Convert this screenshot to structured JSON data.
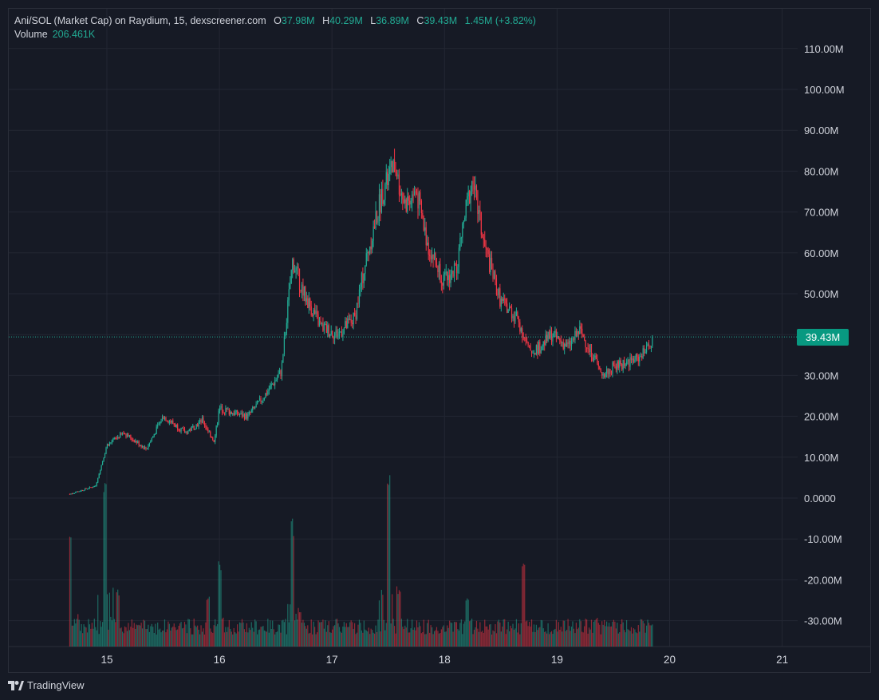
{
  "legend": {
    "title": "Ani/SOL (Market Cap) on Raydium, 15, dexscreener.com",
    "o_label": "O",
    "o_value": "37.98M",
    "h_label": "H",
    "h_value": "40.29M",
    "l_label": "L",
    "l_value": "36.89M",
    "c_label": "C",
    "c_value": "39.43M",
    "change": "1.45M (+3.82%)",
    "volume_label": "Volume",
    "volume_value": "206.461K"
  },
  "price_tag": "39.43M",
  "branding": "TradingView",
  "colors": {
    "background": "#161a25",
    "up": "#22ab94",
    "down": "#f23645",
    "grid": "#232733",
    "text": "#d1d4dc",
    "tag": "#089981"
  },
  "chart_data": {
    "type": "candlestick",
    "interval": "15",
    "yaxis_ticks": [
      "110.00M",
      "100.00M",
      "90.00M",
      "80.00M",
      "70.00M",
      "60.00M",
      "50.00M",
      "40.00M",
      "30.00M",
      "20.00M",
      "10.00M",
      "0.0000",
      "-10.00M",
      "-20.00M",
      "-30.00M"
    ],
    "xaxis_ticks": [
      "15",
      "16",
      "17",
      "18",
      "19",
      "20",
      "21"
    ],
    "ylim": [
      -36,
      114
    ],
    "last_close": 39.43,
    "price_path": [
      [
        14.67,
        1
      ],
      [
        14.9,
        3
      ],
      [
        15.0,
        13
      ],
      [
        15.15,
        16
      ],
      [
        15.35,
        12
      ],
      [
        15.5,
        20
      ],
      [
        15.7,
        16
      ],
      [
        15.85,
        19
      ],
      [
        15.95,
        14
      ],
      [
        16.0,
        22
      ],
      [
        16.1,
        21
      ],
      [
        16.25,
        20
      ],
      [
        16.4,
        25
      ],
      [
        16.55,
        31
      ],
      [
        16.6,
        45
      ],
      [
        16.65,
        58
      ],
      [
        16.75,
        50
      ],
      [
        16.9,
        42
      ],
      [
        17.05,
        40
      ],
      [
        17.2,
        44
      ],
      [
        17.3,
        58
      ],
      [
        17.45,
        75
      ],
      [
        17.55,
        81
      ],
      [
        17.65,
        72
      ],
      [
        17.75,
        75
      ],
      [
        17.85,
        62
      ],
      [
        18.0,
        53
      ],
      [
        18.1,
        56
      ],
      [
        18.2,
        72
      ],
      [
        18.25,
        78
      ],
      [
        18.35,
        62
      ],
      [
        18.5,
        48
      ],
      [
        18.65,
        44
      ],
      [
        18.75,
        36
      ],
      [
        18.85,
        37
      ],
      [
        18.95,
        40
      ],
      [
        19.1,
        37
      ],
      [
        19.2,
        41
      ],
      [
        19.3,
        36
      ],
      [
        19.4,
        30
      ],
      [
        19.5,
        32
      ],
      [
        19.6,
        33
      ],
      [
        19.7,
        34
      ],
      [
        19.8,
        36
      ],
      [
        19.85,
        39.43
      ]
    ],
    "volume_spikes": [
      [
        14.67,
        0.6
      ],
      [
        14.98,
        0.85
      ],
      [
        15.1,
        0.3
      ],
      [
        15.9,
        0.25
      ],
      [
        16.0,
        0.45
      ],
      [
        16.65,
        0.65
      ],
      [
        17.5,
        0.95
      ],
      [
        17.6,
        0.3
      ],
      [
        18.2,
        0.25
      ],
      [
        18.7,
        0.45
      ],
      [
        19.35,
        0.15
      ],
      [
        19.85,
        0.12
      ]
    ]
  }
}
